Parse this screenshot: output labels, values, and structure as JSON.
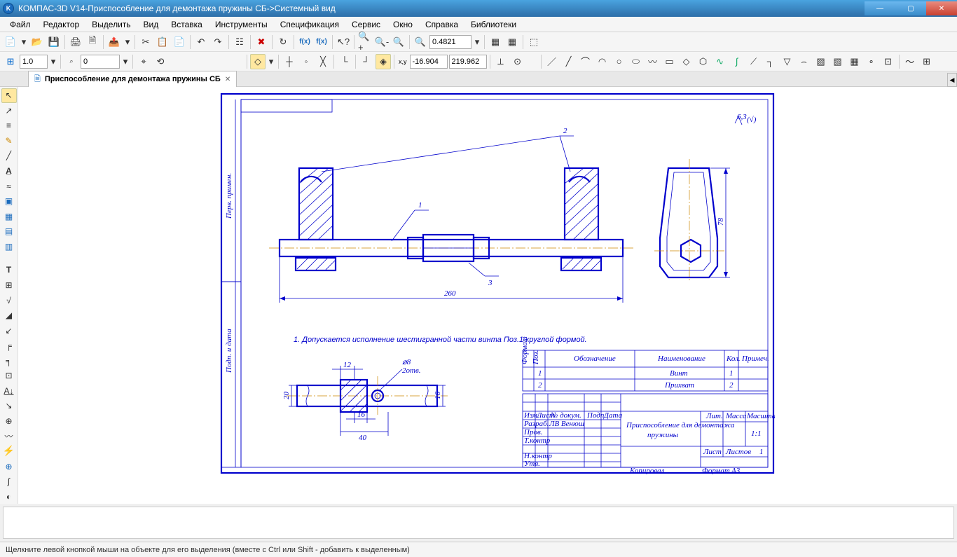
{
  "titlebar": {
    "app": "КОМПАС-3D V14",
    "doc": "Приспособление для демонтажа  пружины СБ",
    "view": "Системный вид",
    "sep1": " - ",
    "sep2": " ->"
  },
  "menubar": {
    "file": "Файл",
    "edit": "Редактор",
    "select": "Выделить",
    "view": "Вид",
    "insert": "Вставка",
    "tools": "Инструменты",
    "spec": "Спецификация",
    "service": "Сервис",
    "window": "Окно",
    "help": "Справка",
    "libs": "Библиотеки"
  },
  "toolbar1": {
    "zoom_value": "0.4821"
  },
  "toolbar2": {
    "field1": "1.0",
    "field2": "0",
    "coordX": "-16.904",
    "coordY": "219.962"
  },
  "doctab": {
    "title": "Приспособление для демонтажа  пружины СБ"
  },
  "statusbar": {
    "text": "Щелкните левой кнопкой мыши на объекте для его выделения (вместе с Ctrl или Shift - добавить к выделенным)"
  },
  "drawing": {
    "callout1": "1",
    "callout2": "2",
    "callout3": "3",
    "dim_main_len": "260",
    "dim_height": "78",
    "note": "1. Допускается исполнение шестигранной части винта Поз.1 круглой формой.",
    "dim_20": "20",
    "dim_12": "12",
    "dim_phi8": "⌀8",
    "dim_2otv": "2отв.",
    "dim_16h": "16",
    "dim_16v": "16",
    "dim_40": "40",
    "surface_mark": "6,3",
    "surface_sqrt": "√(√)",
    "spec": {
      "h_poz": "Поз.",
      "h_oboz": "Обозначение",
      "h_naim": "Наименование",
      "h_kol": "Кол.",
      "h_prim": "Примеч.",
      "r1_poz": "1",
      "r1_naim": "Винт",
      "r1_kol": "1",
      "r2_poz": "2",
      "r2_naim": "Прихват",
      "r2_kol": "2"
    },
    "titleblock": {
      "razrab": "Разраб.",
      "prov": "Пров.",
      "tkontr": "Т.контр",
      "nkontr": "Н.контр",
      "utv": "Утв.",
      "name_line1": "Приспособление для демонтажа",
      "name_line2": "пружины",
      "scale": "1:1",
      "list": "Лист",
      "listov": "Листов",
      "listov_val": "1",
      "mass": "Масса",
      "masshtab": "Масштаб",
      "format": "Формат",
      "format_val": "А3",
      "kopiroval": "Копировал",
      "author": "ЛВ Венюш",
      "izm": "Изм.",
      "podp": "Подп.",
      "data": "Дата",
      "listcol": "Лист",
      "ndokum": "№ докум.",
      "lit": "Лит."
    }
  }
}
